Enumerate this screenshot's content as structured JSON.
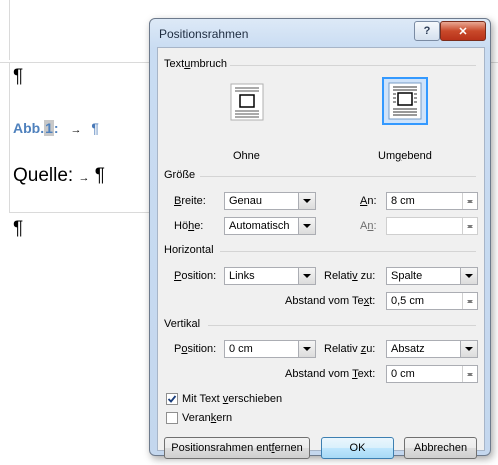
{
  "document": {
    "pilcrow": "¶",
    "caption_label": "Abb.",
    "caption_number": "1",
    "caption_colon": ":",
    "tab_arrow": "→",
    "source_label": "Quelle:"
  },
  "dialog": {
    "title": "Positionsrahmen",
    "help_label": "?",
    "close_label": "✕",
    "textumbruch": {
      "group_label_pre": "Text",
      "group_label_u": "u",
      "group_label_post": "mbruch",
      "option_none_label": "Ohne",
      "option_wrap_pre": "Um",
      "option_wrap_u": "g",
      "option_wrap_post": "ebend"
    },
    "groesse": {
      "group_label": "Größe",
      "width_label_u": "B",
      "width_label_post": "reite:",
      "width_value": "Genau",
      "width_at_label_u": "A",
      "width_at_label_post": "n:",
      "width_at_value": "8 cm",
      "height_label_pre": "Hö",
      "height_label_u": "h",
      "height_label_post": "e:",
      "height_value": "Automatisch",
      "height_at_label_pre": "A",
      "height_at_label_u": "n",
      "height_at_label_post": ":",
      "height_at_value": ""
    },
    "horizontal": {
      "group_label": "Horizontal",
      "position_label_u": "P",
      "position_label_post": "osition:",
      "position_value": "Links",
      "relative_label_pre": "Relati",
      "relative_label_u": "v",
      "relative_label_post": " zu:",
      "relative_value": "Spalte",
      "distance_label_pre": "Abstand vom Te",
      "distance_label_u": "x",
      "distance_label_post": "t:",
      "distance_value": "0,5 cm"
    },
    "vertikal": {
      "group_label": "Vertikal",
      "position_label_pre": "P",
      "position_label_u": "o",
      "position_label_post": "sition:",
      "position_value": "0 cm",
      "relative_label_pre": "Relativ ",
      "relative_label_u": "z",
      "relative_label_post": "u:",
      "relative_value": "Absatz",
      "distance_label_pre": "Abstand vom ",
      "distance_label_u": "T",
      "distance_label_post": "ext:",
      "distance_value": "0 cm"
    },
    "move_with_text_pre": "Mit Text ",
    "move_with_text_u": "v",
    "move_with_text_post": "erschieben",
    "move_with_text_checked": true,
    "anchor_pre": "Veran",
    "anchor_u": "k",
    "anchor_post": "ern",
    "anchor_checked": false,
    "remove_frame_pre": "Positionsrahmen ent",
    "remove_frame_u": "f",
    "remove_frame_post": "ernen",
    "ok_label": "OK",
    "cancel_label": "Abbrechen"
  },
  "colors": {
    "caption_blue": "#4f81bd",
    "pilcrow_blue": "#4a7ab8",
    "selected_icon_border": "#3399ff"
  }
}
